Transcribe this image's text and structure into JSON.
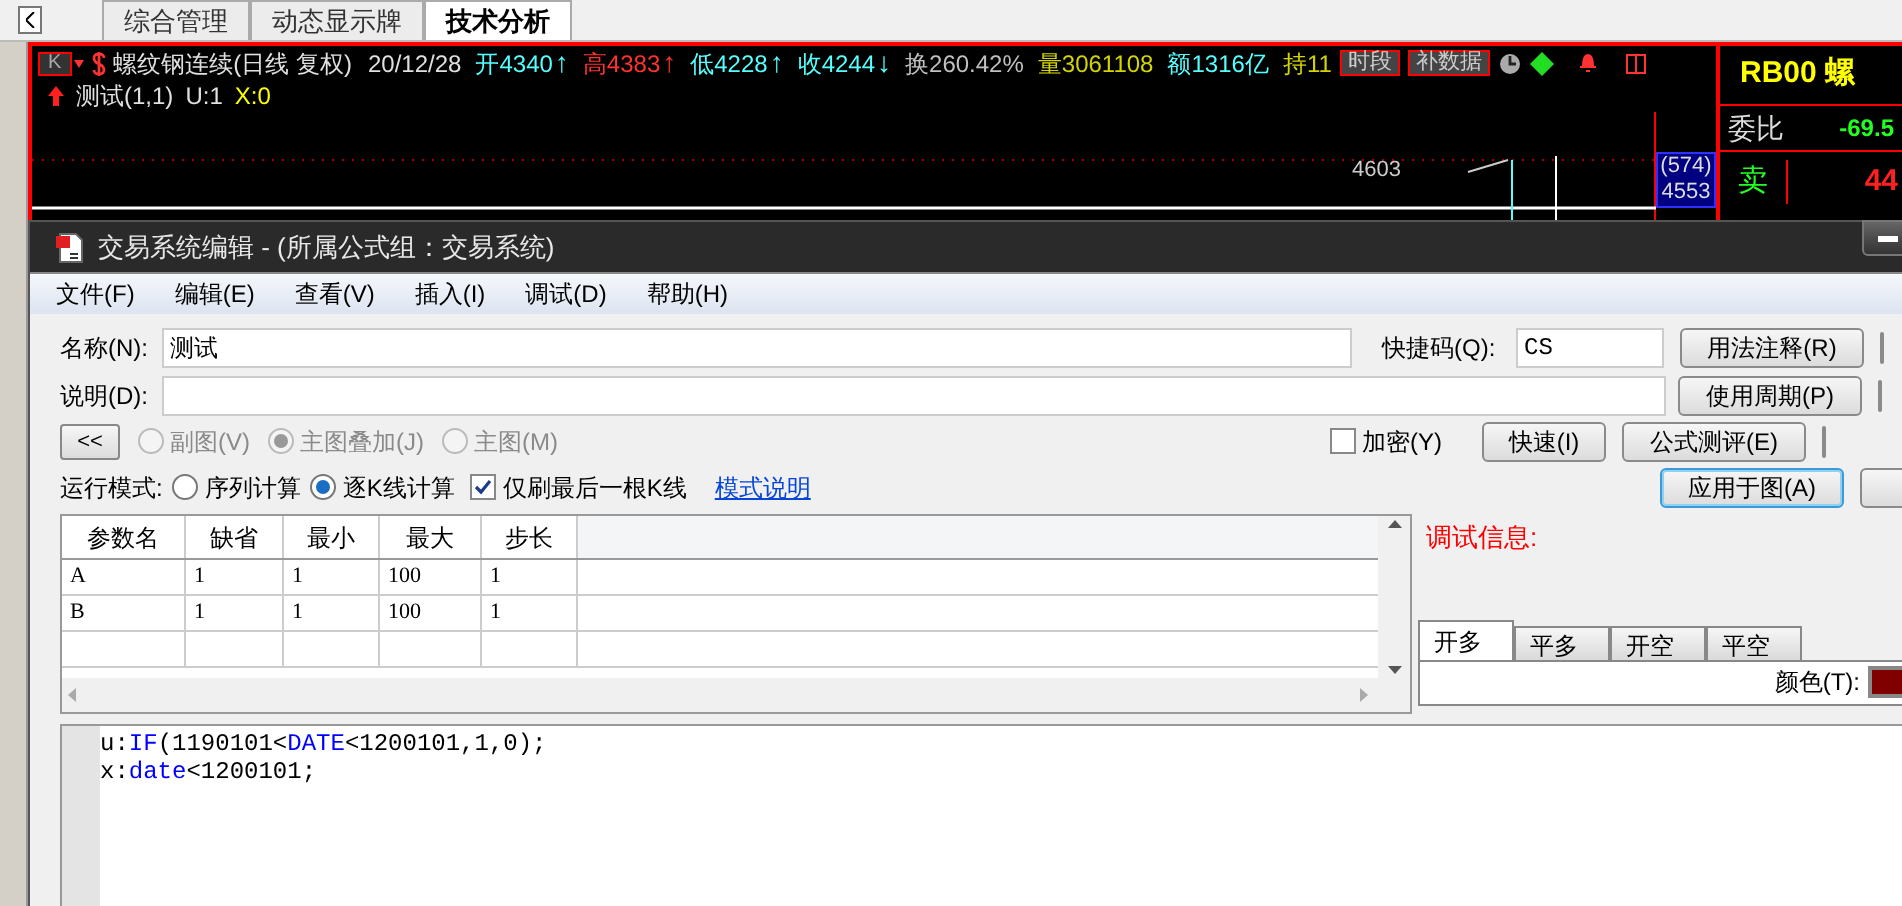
{
  "top_tabs": [
    {
      "label": "综合管理",
      "selected": false
    },
    {
      "label": "动态显示牌",
      "selected": false
    },
    {
      "label": "技术分析",
      "selected": true
    }
  ],
  "chart_header": {
    "period_button": "K",
    "title": "螺纹钢连续(日线 复权)",
    "date": "20/12/28",
    "quotes": [
      {
        "text": "开4340",
        "color": "#55ffff"
      },
      {
        "text": "↑",
        "color": "#55ffff"
      },
      {
        "text": "高4383",
        "color": "#ff3232"
      },
      {
        "text": "↑",
        "color": "#ff3232"
      },
      {
        "text": "低4228",
        "color": "#55ffff"
      },
      {
        "text": "↑",
        "color": "#55ffff"
      },
      {
        "text": "收4244",
        "color": "#55ffff"
      },
      {
        "text": "↓",
        "color": "#55ffff"
      },
      {
        "text": "换260.42%",
        "color": "#c0c0c0"
      },
      {
        "text": "量3061108",
        "color": "#d4d400"
      },
      {
        "text": "额1316亿",
        "color": "#55ffff"
      },
      {
        "text": "持11",
        "color": "#d4d400"
      }
    ],
    "buttons": [
      "时段",
      "补数据"
    ]
  },
  "indicator_line": {
    "name": "测试(1,1)",
    "u_value": "U:1",
    "x_value": "X:0"
  },
  "chart": {
    "price_label": "4603",
    "axis_labels": [
      "(574)",
      "4553"
    ]
  },
  "quote_panel": {
    "symbol": "RB00 螺",
    "ratio_label": "委比",
    "ratio_value": "-69.5",
    "sell_label": "卖",
    "sell_value": "44"
  },
  "dialog": {
    "title": "交易系统编辑 - (所属公式组：交易系统)",
    "menu": [
      "文件(F)",
      "编辑(E)",
      "查看(V)",
      "插入(I)",
      "调试(D)",
      "帮助(H)"
    ],
    "name_label": "名称(N):",
    "name_value": "测试",
    "shortcut_label": "快捷码(Q):",
    "shortcut_value": "CS",
    "desc_label": "说明(D):",
    "collapse_button": "<<",
    "chart_types": [
      {
        "label": "副图(V)",
        "selected": false,
        "disabled": true
      },
      {
        "label": "主图叠加(J)",
        "selected": true,
        "disabled": true
      },
      {
        "label": "主图(M)",
        "selected": false,
        "disabled": true
      }
    ],
    "encrypt": {
      "label": "加密(Y)",
      "checked": false
    },
    "fast_button": "快速(I)",
    "side_buttons": [
      {
        "label": "用法注释(R)",
        "focused": false
      },
      {
        "label": "使用周期(P)",
        "focused": false
      },
      {
        "label": "公式测评(E)",
        "focused": false
      },
      {
        "label": "应用于图(A)",
        "focused": true
      }
    ],
    "run_mode_label": "运行模式:",
    "run_modes": [
      {
        "label": "序列计算",
        "selected": false
      },
      {
        "label": "逐K线计算",
        "selected": true
      }
    ],
    "refresh_last": {
      "label": "仅刷最后一根K线",
      "checked": true
    },
    "mode_help_link": "模式说明",
    "param_table": {
      "columns": [
        "参数名",
        "缺省",
        "最小",
        "最大",
        "步长"
      ],
      "rows": [
        [
          "A",
          "1",
          "1",
          "100",
          "1"
        ],
        [
          "B",
          "1",
          "1",
          "100",
          "1"
        ]
      ]
    },
    "debug_label": "调试信息:",
    "signal_tabs": [
      {
        "label": "开多",
        "selected": true
      },
      {
        "label": "平多",
        "selected": false
      },
      {
        "label": "开空",
        "selected": false
      },
      {
        "label": "平空",
        "selected": false
      }
    ],
    "color_label": "颜色(T):",
    "color_swatch": {
      "color": "#800000"
    },
    "code_lines": [
      [
        {
          "text": "u:",
          "kind": "plain"
        },
        {
          "text": "IF",
          "kind": "keyword"
        },
        {
          "text": "(1190101<",
          "kind": "plain"
        },
        {
          "text": "DATE",
          "kind": "keyword"
        },
        {
          "text": "<1200101,1,0);",
          "kind": "plain"
        }
      ],
      [
        {
          "text": "x:",
          "kind": "plain"
        },
        {
          "text": "date",
          "kind": "keyword"
        },
        {
          "text": "<1200101;",
          "kind": "plain"
        }
      ]
    ]
  }
}
